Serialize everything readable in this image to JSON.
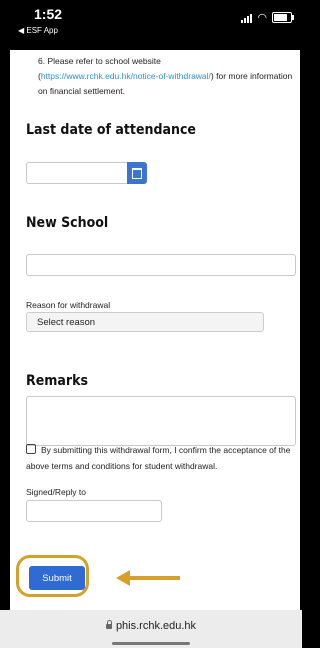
{
  "status_bar": {
    "time": "1:52",
    "back_app": "◀ ESF App",
    "icons": [
      "signal-icon",
      "wifi-icon",
      "battery-icon"
    ]
  },
  "form": {
    "item_6": {
      "number": "6.",
      "text_before": "Please refer to school website",
      "link": "https://www.rchk.edu.hk/notice-of-withdrawal/",
      "text_after": "for more information on financial settlement."
    },
    "last_date_heading": "Last date of attendance",
    "new_school_heading": "New School",
    "reason_label": "Reason for withdrawal",
    "reason_select": "Select reason",
    "remarks_heading": "Remarks",
    "consent_text": "By submitting this withdrawal form, I confirm the acceptance of the above terms and conditions for student withdrawal.",
    "signed_label": "Signed/Reply to",
    "submit_label": "Submit"
  },
  "highlight_color": "#d6a12a",
  "url_bar": {
    "url": "phis.rchk.edu.hk"
  }
}
